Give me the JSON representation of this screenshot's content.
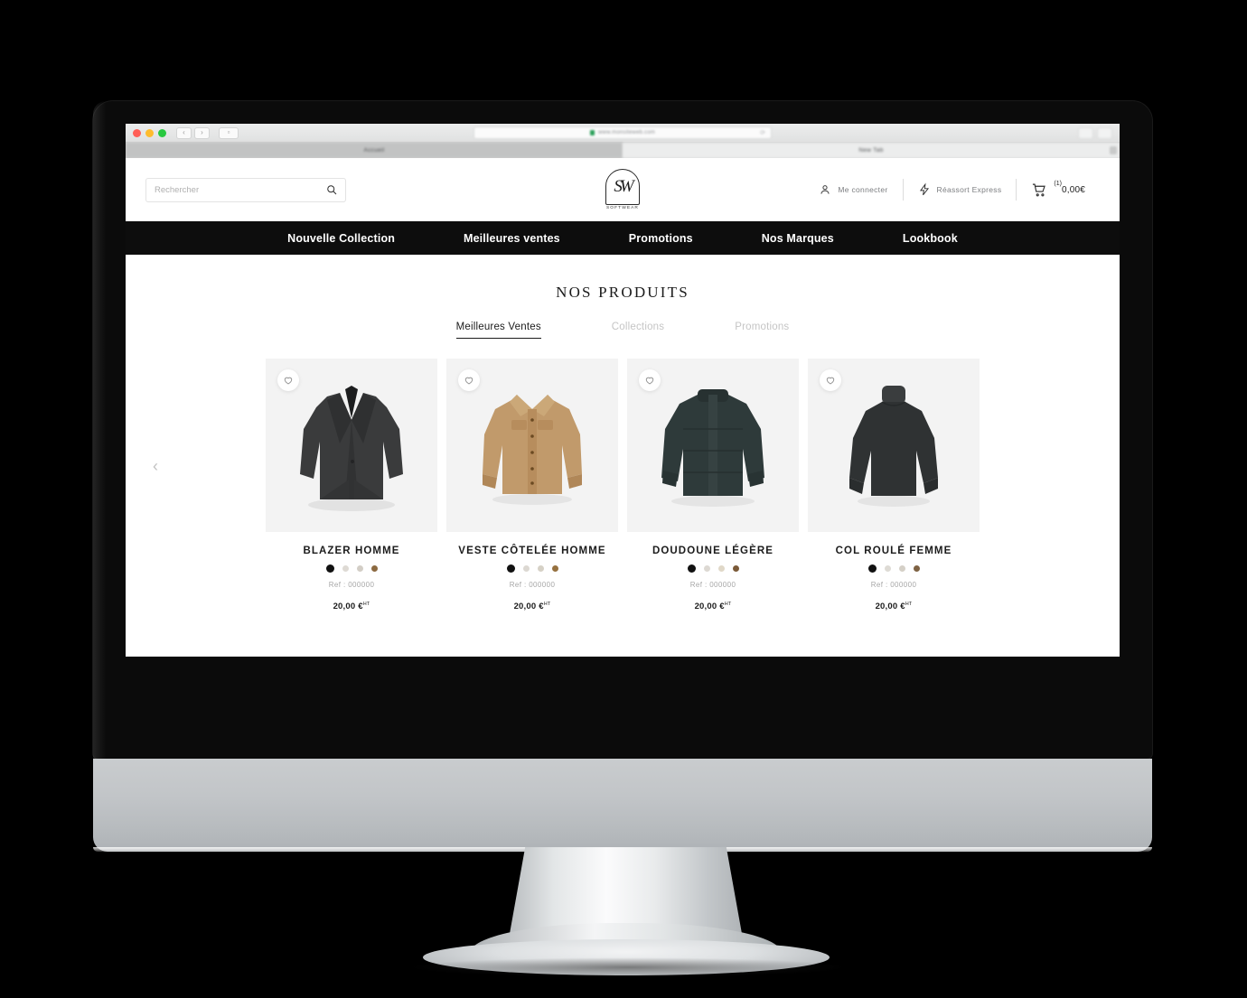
{
  "browser": {
    "traffic_lights": [
      "close",
      "minimize",
      "maximize"
    ],
    "back_label": "‹",
    "forward_label": "›",
    "sidebar_label": "▫",
    "url": "www.monsiteweb.com",
    "reload_label": "⟳",
    "tabs": [
      {
        "label": "Accueil",
        "active": true
      },
      {
        "label": "New Tab",
        "active": false
      }
    ]
  },
  "header": {
    "search": {
      "placeholder": "Rechercher",
      "value": ""
    },
    "logo": {
      "monogram": "SW",
      "wordmark": "SOFTWEAR"
    },
    "account_label": "Me connecter",
    "reassort_label": "Réassort Express",
    "cart": {
      "count": "(1)",
      "amount": "0,00€"
    }
  },
  "nav": {
    "items": [
      {
        "label": "Nouvelle Collection"
      },
      {
        "label": "Meilleures ventes"
      },
      {
        "label": "Promotions"
      },
      {
        "label": "Nos Marques"
      },
      {
        "label": "Lookbook"
      }
    ]
  },
  "main": {
    "title": "NOS PRODUITS",
    "tabs": [
      {
        "label": "Meilleures Ventes",
        "active": true
      },
      {
        "label": "Collections",
        "active": false
      },
      {
        "label": "Promotions",
        "active": false
      }
    ],
    "prev_arrow": "‹",
    "products": [
      {
        "name": "BLAZER HOMME",
        "ref": "Ref : 000000",
        "price": "20,00 €",
        "price_sup": "HT",
        "garment": "blazer",
        "garment_color": "#3a3b3c",
        "fav_icon": "heart-icon",
        "swatches": [
          {
            "color": "#111111",
            "selected": true
          },
          {
            "color": "#dedad4",
            "selected": false
          },
          {
            "color": "#d3cec6",
            "selected": false
          },
          {
            "color": "#8c6a41",
            "selected": false
          }
        ]
      },
      {
        "name": "VESTE CÔTELÉE HOMME",
        "ref": "Ref : 000000",
        "price": "20,00 €",
        "price_sup": "HT",
        "garment": "shirt-jacket",
        "garment_color": "#c19a6b",
        "fav_icon": "heart-icon",
        "swatches": [
          {
            "color": "#111111",
            "selected": true
          },
          {
            "color": "#dcd8d2",
            "selected": false
          },
          {
            "color": "#d6d1c6",
            "selected": false
          },
          {
            "color": "#96713f",
            "selected": false
          }
        ]
      },
      {
        "name": "DOUDOUNE LÉGÈRE",
        "ref": "Ref : 000000",
        "price": "20,00 €",
        "price_sup": "HT",
        "garment": "puffer",
        "garment_color": "#2e3a3a",
        "fav_icon": "heart-icon",
        "swatches": [
          {
            "color": "#111111",
            "selected": true
          },
          {
            "color": "#ddd9d3",
            "selected": false
          },
          {
            "color": "#e0d8c8",
            "selected": false
          },
          {
            "color": "#7b5a38",
            "selected": false
          }
        ]
      },
      {
        "name": "COL ROULÉ FEMME",
        "ref": "Ref : 000000",
        "price": "20,00 €",
        "price_sup": "HT",
        "garment": "turtleneck",
        "garment_color": "#2f3233",
        "fav_icon": "heart-icon",
        "swatches": [
          {
            "color": "#111111",
            "selected": true
          },
          {
            "color": "#dedbd5",
            "selected": false
          },
          {
            "color": "#d5d0c7",
            "selected": false
          },
          {
            "color": "#7e6243",
            "selected": false
          }
        ]
      }
    ]
  },
  "colors": {
    "nav_background": "#0d0d0d",
    "page_background": "#ffffff",
    "thumb_background": "#f3f3f3",
    "muted_text": "#a7a7a7",
    "bezel": "#0b0b0b"
  }
}
